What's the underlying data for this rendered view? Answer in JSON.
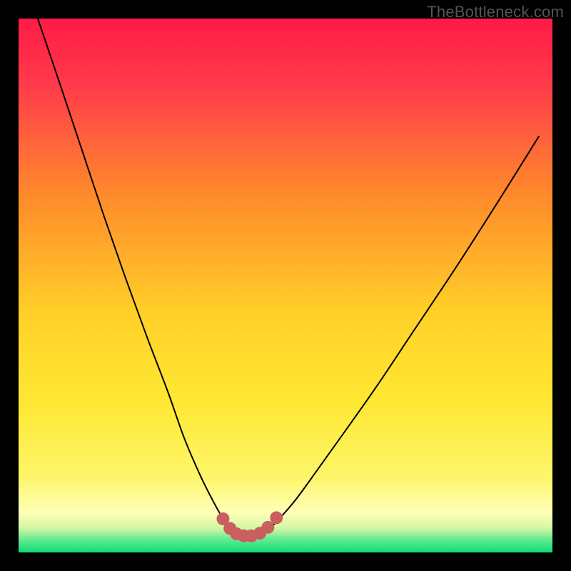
{
  "watermark": "TheBottleneck.com",
  "colors": {
    "frame": "#000000",
    "curve": "#000000",
    "dots": "#cb5f5d",
    "gradient_top": "#ff1a46",
    "gradient_mid_upper": "#ff7a2a",
    "gradient_mid": "#ffe328",
    "gradient_pale": "#ffffa8",
    "gradient_green": "#14e27a"
  },
  "chart_data": {
    "type": "line",
    "title": "",
    "xlabel": "",
    "ylabel": "",
    "xlim": [
      0,
      100
    ],
    "ylim": [
      0,
      100
    ],
    "grid": false,
    "legend": false,
    "series": [
      {
        "name": "bottleneck-curve",
        "x": [
          3.6,
          8,
          12,
          16,
          20,
          24,
          28,
          31,
          34,
          36.5,
          38.5,
          40,
          41.5,
          43,
          44.5,
          46.5,
          49,
          52,
          56,
          61,
          67,
          74,
          82,
          90,
          97.5
        ],
        "y": [
          100,
          87,
          75,
          63,
          51.5,
          40.5,
          30,
          21.5,
          14.5,
          9.5,
          6,
          4,
          3,
          3,
          3,
          4,
          6.5,
          10,
          15.5,
          22.5,
          31,
          41.5,
          53.5,
          66,
          78
        ]
      }
    ],
    "markers": {
      "name": "flat-bottom-dots",
      "x": [
        38.3,
        39.6,
        40.8,
        42.2,
        43.6,
        45.2,
        46.7,
        48.3
      ],
      "y": [
        6.3,
        4.5,
        3.5,
        3.1,
        3.1,
        3.6,
        4.7,
        6.5
      ]
    },
    "gradient_stops": [
      {
        "offset": 0.0,
        "color": "#ff1a46"
      },
      {
        "offset": 0.13,
        "color": "#ff3d4a"
      },
      {
        "offset": 0.33,
        "color": "#ff8a2b"
      },
      {
        "offset": 0.55,
        "color": "#ffd028"
      },
      {
        "offset": 0.72,
        "color": "#ffe833"
      },
      {
        "offset": 0.86,
        "color": "#fdf66a"
      },
      {
        "offset": 0.925,
        "color": "#ffffb8"
      },
      {
        "offset": 0.955,
        "color": "#d2f7a2"
      },
      {
        "offset": 0.975,
        "color": "#66eb92"
      },
      {
        "offset": 1.0,
        "color": "#0fdc76"
      }
    ]
  }
}
